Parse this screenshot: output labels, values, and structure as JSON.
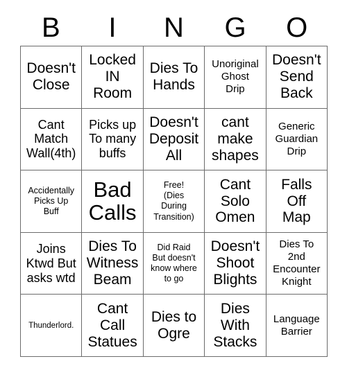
{
  "card": {
    "title": "BINGO",
    "header_letters": [
      "B",
      "I",
      "N",
      "G",
      "O"
    ],
    "columns": 5,
    "rows": 5,
    "colors": {
      "background": "#ffffff",
      "text": "#000000",
      "grid_line": "#6b6b6b"
    },
    "cells": [
      {
        "text": "Doesn't\nClose",
        "size": "lg",
        "free": false
      },
      {
        "text": "Locked\nIN\nRoom",
        "size": "lg",
        "free": false
      },
      {
        "text": "Dies To\nHands",
        "size": "lg",
        "free": false
      },
      {
        "text": "Unoriginal\nGhost\nDrip",
        "size": "sm",
        "free": false
      },
      {
        "text": "Doesn't\nSend\nBack",
        "size": "lg",
        "free": false
      },
      {
        "text": "Cant\nMatch\nWall(4th)",
        "size": "md",
        "free": false
      },
      {
        "text": "Picks up\nTo many\nbuffs",
        "size": "md",
        "free": false
      },
      {
        "text": "Doesn't\nDeposit\nAll",
        "size": "lg",
        "free": false
      },
      {
        "text": "cant\nmake\nshapes",
        "size": "lg",
        "free": false
      },
      {
        "text": "Generic\nGuardian\nDrip",
        "size": "sm",
        "free": false
      },
      {
        "text": "Accidentally\nPicks Up\nBuff",
        "size": "xs",
        "free": false
      },
      {
        "text": "Bad\nCalls",
        "size": "xl",
        "free": false
      },
      {
        "text": "Free!\n(Dies\nDuring\nTransition)",
        "size": "xs",
        "free": true
      },
      {
        "text": "Cant\nSolo\nOmen",
        "size": "lg",
        "free": false
      },
      {
        "text": "Falls\nOff\nMap",
        "size": "lg",
        "free": false
      },
      {
        "text": "Joins\nKtwd But\nasks wtd",
        "size": "md",
        "free": false
      },
      {
        "text": "Dies To\nWitness\nBeam",
        "size": "lg",
        "free": false
      },
      {
        "text": "Did Raid\nBut doesn't\nknow where\nto go",
        "size": "xs",
        "free": false
      },
      {
        "text": "Doesn't\nShoot\nBlights",
        "size": "lg",
        "free": false
      },
      {
        "text": "Dies To\n2nd\nEncounter\nKnight",
        "size": "sm",
        "free": false
      },
      {
        "text": "Thunderlord.",
        "size": "xxs",
        "free": false
      },
      {
        "text": "Cant\nCall\nStatues",
        "size": "lg",
        "free": false
      },
      {
        "text": "Dies to\nOgre",
        "size": "lg",
        "free": false
      },
      {
        "text": "Dies\nWith\nStacks",
        "size": "lg",
        "free": false
      },
      {
        "text": "Language\nBarrier",
        "size": "sm",
        "free": false
      }
    ]
  }
}
